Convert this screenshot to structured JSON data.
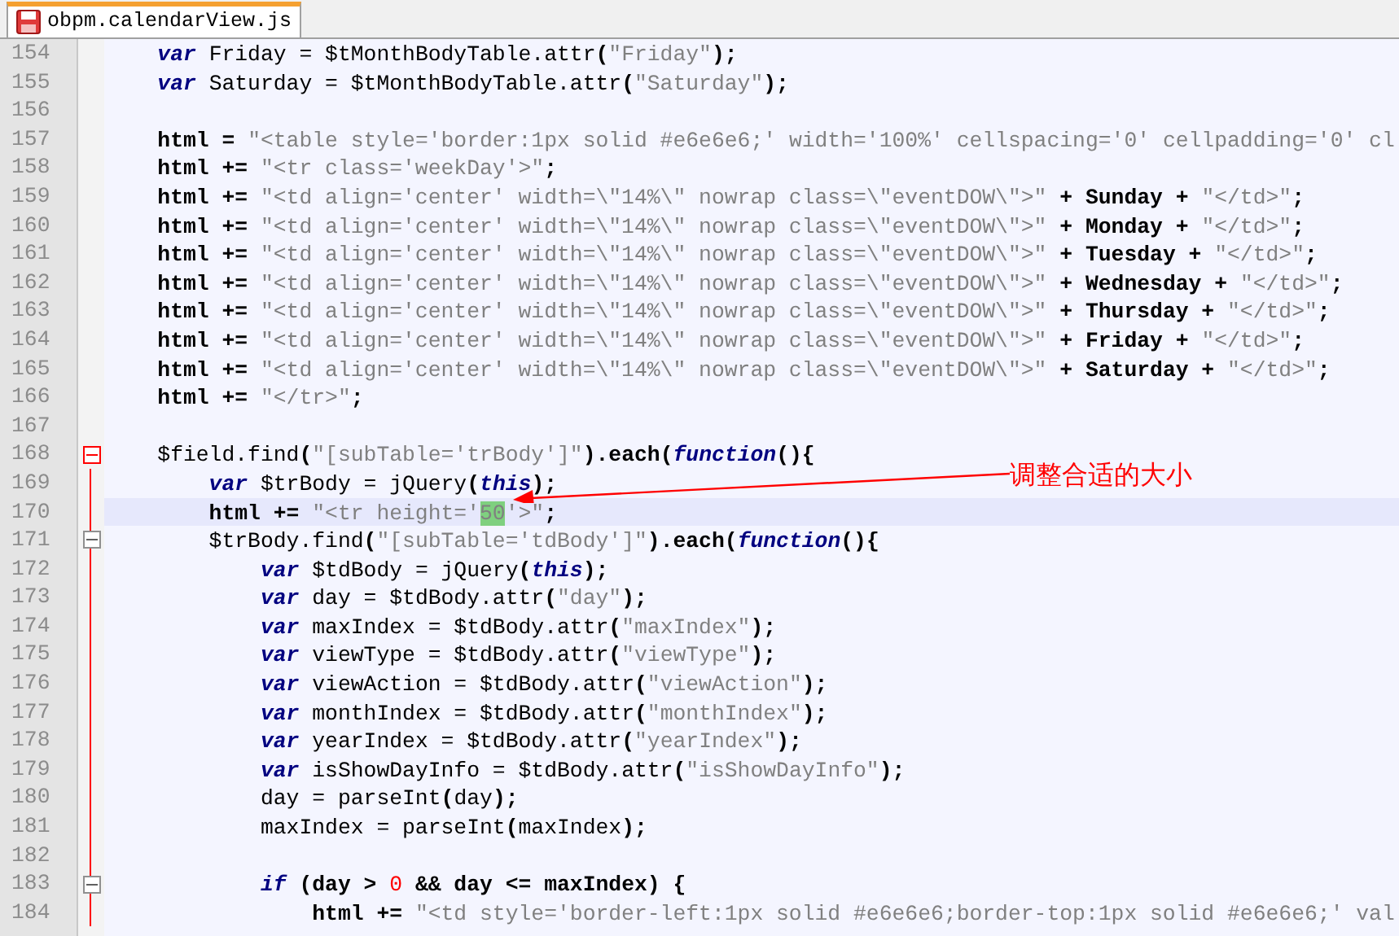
{
  "tab": {
    "label": "obpm.calendarView.js",
    "selected": true
  },
  "lines": [
    {
      "number": "154",
      "tokens": [
        {
          "kind": "kw",
          "text": "    var"
        },
        {
          "kind": "txt",
          "text": " Friday = $tMonthBodyTable.attr"
        },
        {
          "kind": "b",
          "text": "("
        },
        {
          "kind": "str",
          "text": "\"Friday\""
        },
        {
          "kind": "b",
          "text": ");"
        }
      ]
    },
    {
      "number": "155",
      "tokens": [
        {
          "kind": "kw",
          "text": "    var"
        },
        {
          "kind": "txt",
          "text": " Saturday = $tMonthBodyTable.attr"
        },
        {
          "kind": "b",
          "text": "("
        },
        {
          "kind": "str",
          "text": "\"Saturday\""
        },
        {
          "kind": "b",
          "text": ");"
        }
      ]
    },
    {
      "number": "156"
    },
    {
      "number": "157",
      "tokens": [
        {
          "kind": "b",
          "text": "    html = "
        },
        {
          "kind": "str",
          "text": "\"<table style='border:1px solid #e6e6e6;' width='100%' cellspacing='0' cellpadding='0' cl"
        }
      ]
    },
    {
      "number": "158",
      "tokens": [
        {
          "kind": "b",
          "text": "    html += "
        },
        {
          "kind": "str",
          "text": "\"<tr class='weekDay'>\""
        },
        {
          "kind": "b",
          "text": ";"
        }
      ]
    },
    {
      "number": "159",
      "tokens": [
        {
          "kind": "b",
          "text": "    html += "
        },
        {
          "kind": "str",
          "text": "\"<td align='center' width=\\\"14%\\\" nowrap class=\\\"eventDOW\\\">\""
        },
        {
          "kind": "b",
          "text": " + Sunday + "
        },
        {
          "kind": "str",
          "text": "\"</td>\""
        },
        {
          "kind": "b",
          "text": ";"
        }
      ]
    },
    {
      "number": "160",
      "tokens": [
        {
          "kind": "b",
          "text": "    html += "
        },
        {
          "kind": "str",
          "text": "\"<td align='center' width=\\\"14%\\\" nowrap class=\\\"eventDOW\\\">\""
        },
        {
          "kind": "b",
          "text": " + Monday + "
        },
        {
          "kind": "str",
          "text": "\"</td>\""
        },
        {
          "kind": "b",
          "text": ";"
        }
      ]
    },
    {
      "number": "161",
      "tokens": [
        {
          "kind": "b",
          "text": "    html += "
        },
        {
          "kind": "str",
          "text": "\"<td align='center' width=\\\"14%\\\" nowrap class=\\\"eventDOW\\\">\""
        },
        {
          "kind": "b",
          "text": " + Tuesday + "
        },
        {
          "kind": "str",
          "text": "\"</td>\""
        },
        {
          "kind": "b",
          "text": ";"
        }
      ]
    },
    {
      "number": "162",
      "tokens": [
        {
          "kind": "b",
          "text": "    html += "
        },
        {
          "kind": "str",
          "text": "\"<td align='center' width=\\\"14%\\\" nowrap class=\\\"eventDOW\\\">\""
        },
        {
          "kind": "b",
          "text": " + Wednesday + "
        },
        {
          "kind": "str",
          "text": "\"</td>\""
        },
        {
          "kind": "b",
          "text": ";"
        }
      ]
    },
    {
      "number": "163",
      "tokens": [
        {
          "kind": "b",
          "text": "    html += "
        },
        {
          "kind": "str",
          "text": "\"<td align='center' width=\\\"14%\\\" nowrap class=\\\"eventDOW\\\">\""
        },
        {
          "kind": "b",
          "text": " + Thursday + "
        },
        {
          "kind": "str",
          "text": "\"</td>\""
        },
        {
          "kind": "b",
          "text": ";"
        }
      ]
    },
    {
      "number": "164",
      "tokens": [
        {
          "kind": "b",
          "text": "    html += "
        },
        {
          "kind": "str",
          "text": "\"<td align='center' width=\\\"14%\\\" nowrap class=\\\"eventDOW\\\">\""
        },
        {
          "kind": "b",
          "text": " + Friday + "
        },
        {
          "kind": "str",
          "text": "\"</td>\""
        },
        {
          "kind": "b",
          "text": ";"
        }
      ]
    },
    {
      "number": "165",
      "tokens": [
        {
          "kind": "b",
          "text": "    html += "
        },
        {
          "kind": "str",
          "text": "\"<td align='center' width=\\\"14%\\\" nowrap class=\\\"eventDOW\\\">\""
        },
        {
          "kind": "b",
          "text": " + Saturday + "
        },
        {
          "kind": "str",
          "text": "\"</td>\""
        },
        {
          "kind": "b",
          "text": ";"
        }
      ]
    },
    {
      "number": "166",
      "tokens": [
        {
          "kind": "b",
          "text": "    html += "
        },
        {
          "kind": "str",
          "text": "\"</tr>\""
        },
        {
          "kind": "b",
          "text": ";"
        }
      ]
    },
    {
      "number": "167"
    },
    {
      "number": "168",
      "fold_marker": true,
      "fold_highlight": true,
      "tokens": [
        {
          "kind": "txt",
          "text": "    $field.find"
        },
        {
          "kind": "b",
          "text": "("
        },
        {
          "kind": "str",
          "text": "\"[subTable='trBody']\""
        },
        {
          "kind": "b",
          "text": ").each("
        },
        {
          "kind": "kw",
          "text": "function"
        },
        {
          "kind": "b",
          "text": "(){"
        }
      ]
    },
    {
      "number": "169",
      "tokens": [
        {
          "kind": "kw",
          "text": "        var"
        },
        {
          "kind": "txt",
          "text": " $trBody = jQuery"
        },
        {
          "kind": "b",
          "text": "("
        },
        {
          "kind": "kw",
          "text": "this"
        },
        {
          "kind": "b",
          "text": ");"
        }
      ]
    },
    {
      "number": "170",
      "current": true,
      "tokens": [
        {
          "kind": "b",
          "text": "        html += "
        },
        {
          "kind": "str",
          "text": "\"<tr height='"
        },
        {
          "kind": "hl",
          "text": "50"
        },
        {
          "kind": "str",
          "text": "'>\""
        },
        {
          "kind": "b",
          "text": ";"
        }
      ]
    },
    {
      "number": "171",
      "fold_marker": true,
      "fold_highlight": false,
      "tokens": [
        {
          "kind": "txt",
          "text": "        $trBody.find"
        },
        {
          "kind": "b",
          "text": "("
        },
        {
          "kind": "str",
          "text": "\"[subTable='tdBody']\""
        },
        {
          "kind": "b",
          "text": ").each("
        },
        {
          "kind": "kw",
          "text": "function"
        },
        {
          "kind": "b",
          "text": "(){"
        }
      ]
    },
    {
      "number": "172",
      "tokens": [
        {
          "kind": "kw",
          "text": "            var"
        },
        {
          "kind": "txt",
          "text": " $tdBody = jQuery"
        },
        {
          "kind": "b",
          "text": "("
        },
        {
          "kind": "kw",
          "text": "this"
        },
        {
          "kind": "b",
          "text": ");"
        }
      ]
    },
    {
      "number": "173",
      "tokens": [
        {
          "kind": "kw",
          "text": "            var"
        },
        {
          "kind": "txt",
          "text": " day = $tdBody.attr"
        },
        {
          "kind": "b",
          "text": "("
        },
        {
          "kind": "str",
          "text": "\"day\""
        },
        {
          "kind": "b",
          "text": ");"
        }
      ]
    },
    {
      "number": "174",
      "tokens": [
        {
          "kind": "kw",
          "text": "            var"
        },
        {
          "kind": "txt",
          "text": " maxIndex = $tdBody.attr"
        },
        {
          "kind": "b",
          "text": "("
        },
        {
          "kind": "str",
          "text": "\"maxIndex\""
        },
        {
          "kind": "b",
          "text": ");"
        }
      ]
    },
    {
      "number": "175",
      "tokens": [
        {
          "kind": "kw",
          "text": "            var"
        },
        {
          "kind": "txt",
          "text": " viewType = $tdBody.attr"
        },
        {
          "kind": "b",
          "text": "("
        },
        {
          "kind": "str",
          "text": "\"viewType\""
        },
        {
          "kind": "b",
          "text": ");"
        }
      ]
    },
    {
      "number": "176",
      "tokens": [
        {
          "kind": "kw",
          "text": "            var"
        },
        {
          "kind": "txt",
          "text": " viewAction = $tdBody.attr"
        },
        {
          "kind": "b",
          "text": "("
        },
        {
          "kind": "str",
          "text": "\"viewAction\""
        },
        {
          "kind": "b",
          "text": ");"
        }
      ]
    },
    {
      "number": "177",
      "tokens": [
        {
          "kind": "kw",
          "text": "            var"
        },
        {
          "kind": "txt",
          "text": " monthIndex = $tdBody.attr"
        },
        {
          "kind": "b",
          "text": "("
        },
        {
          "kind": "str",
          "text": "\"monthIndex\""
        },
        {
          "kind": "b",
          "text": ");"
        }
      ]
    },
    {
      "number": "178",
      "tokens": [
        {
          "kind": "kw",
          "text": "            var"
        },
        {
          "kind": "txt",
          "text": " yearIndex = $tdBody.attr"
        },
        {
          "kind": "b",
          "text": "("
        },
        {
          "kind": "str",
          "text": "\"yearIndex\""
        },
        {
          "kind": "b",
          "text": ");"
        }
      ]
    },
    {
      "number": "179",
      "tokens": [
        {
          "kind": "kw",
          "text": "            var"
        },
        {
          "kind": "txt",
          "text": " isShowDayInfo = $tdBody.attr"
        },
        {
          "kind": "b",
          "text": "("
        },
        {
          "kind": "str",
          "text": "\"isShowDayInfo\""
        },
        {
          "kind": "b",
          "text": ");"
        }
      ]
    },
    {
      "number": "180",
      "tokens": [
        {
          "kind": "txt",
          "text": "            day = parseInt"
        },
        {
          "kind": "b",
          "text": "("
        },
        {
          "kind": "txt",
          "text": "day"
        },
        {
          "kind": "b",
          "text": ");"
        }
      ]
    },
    {
      "number": "181",
      "tokens": [
        {
          "kind": "txt",
          "text": "            maxIndex = parseInt"
        },
        {
          "kind": "b",
          "text": "("
        },
        {
          "kind": "txt",
          "text": "maxIndex"
        },
        {
          "kind": "b",
          "text": ");"
        }
      ]
    },
    {
      "number": "182"
    },
    {
      "number": "183",
      "fold_marker": true,
      "fold_highlight": false,
      "tokens": [
        {
          "kind": "kw",
          "text": "            if"
        },
        {
          "kind": "b",
          "text": " (day > "
        },
        {
          "kind": "num",
          "text": "0"
        },
        {
          "kind": "b",
          "text": " && day <= maxIndex) {"
        }
      ]
    },
    {
      "number": "184",
      "tokens": [
        {
          "kind": "b",
          "text": "                html += "
        },
        {
          "kind": "str",
          "text": "\"<td style='border-left:1px solid #e6e6e6;border-top:1px solid #e6e6e6;' val"
        }
      ]
    }
  ],
  "annotation": {
    "text": "调整合适的大小"
  }
}
